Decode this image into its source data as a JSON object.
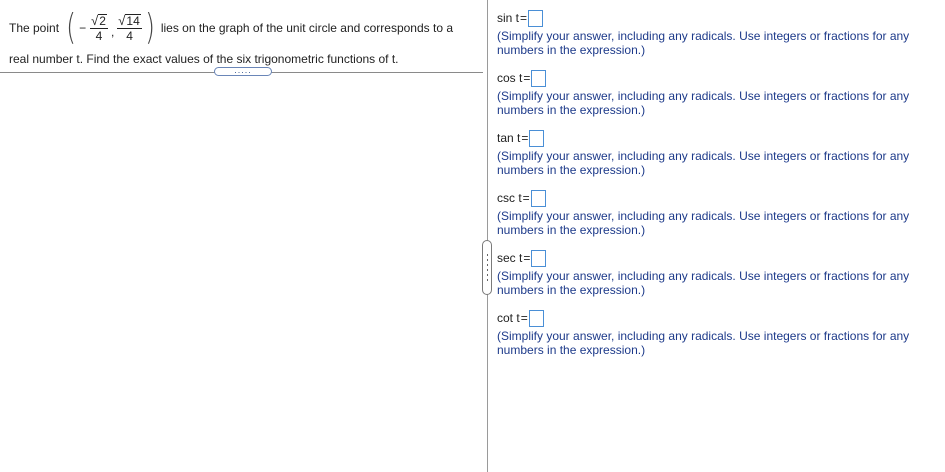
{
  "problem": {
    "intro": "The point",
    "point": {
      "sign": "−",
      "x_radicand": "2",
      "x_denominator": "4",
      "separator": ",",
      "y_radicand": "14",
      "y_denominator": "4"
    },
    "continuation": "lies on the graph of the unit circle and corresponds to a",
    "line2": "real number t. Find the exact values of the six trigonometric functions of t."
  },
  "expand_button": {
    "label": "....."
  },
  "answers": [
    {
      "function": "sin t",
      "equals": "=",
      "value": "",
      "hint": "(Simplify your answer, including any radicals. Use integers or fractions for any numbers in the expression.)"
    },
    {
      "function": "cos t",
      "equals": "=",
      "value": "",
      "hint": "(Simplify your answer, including any radicals. Use integers or fractions for any numbers in the expression.)"
    },
    {
      "function": "tan t",
      "equals": "=",
      "value": "",
      "hint": "(Simplify your answer, including any radicals. Use integers or fractions for any numbers in the expression.)"
    },
    {
      "function": "csc t",
      "equals": "=",
      "value": "",
      "hint": "(Simplify your answer, including any radicals. Use integers or fractions for any numbers in the expression.)"
    },
    {
      "function": "sec t",
      "equals": "=",
      "value": "",
      "hint": "(Simplify your answer, including any radicals. Use integers or fractions for any numbers in the expression.)"
    },
    {
      "function": "cot t",
      "equals": "=",
      "value": "",
      "hint": "(Simplify your answer, including any radicals. Use integers or fractions for any numbers in the expression.)"
    }
  ],
  "colors": {
    "hint_text": "#1d3a8a",
    "answer_box_border": "#4a8fd6",
    "divider": "#9a9a9a"
  }
}
